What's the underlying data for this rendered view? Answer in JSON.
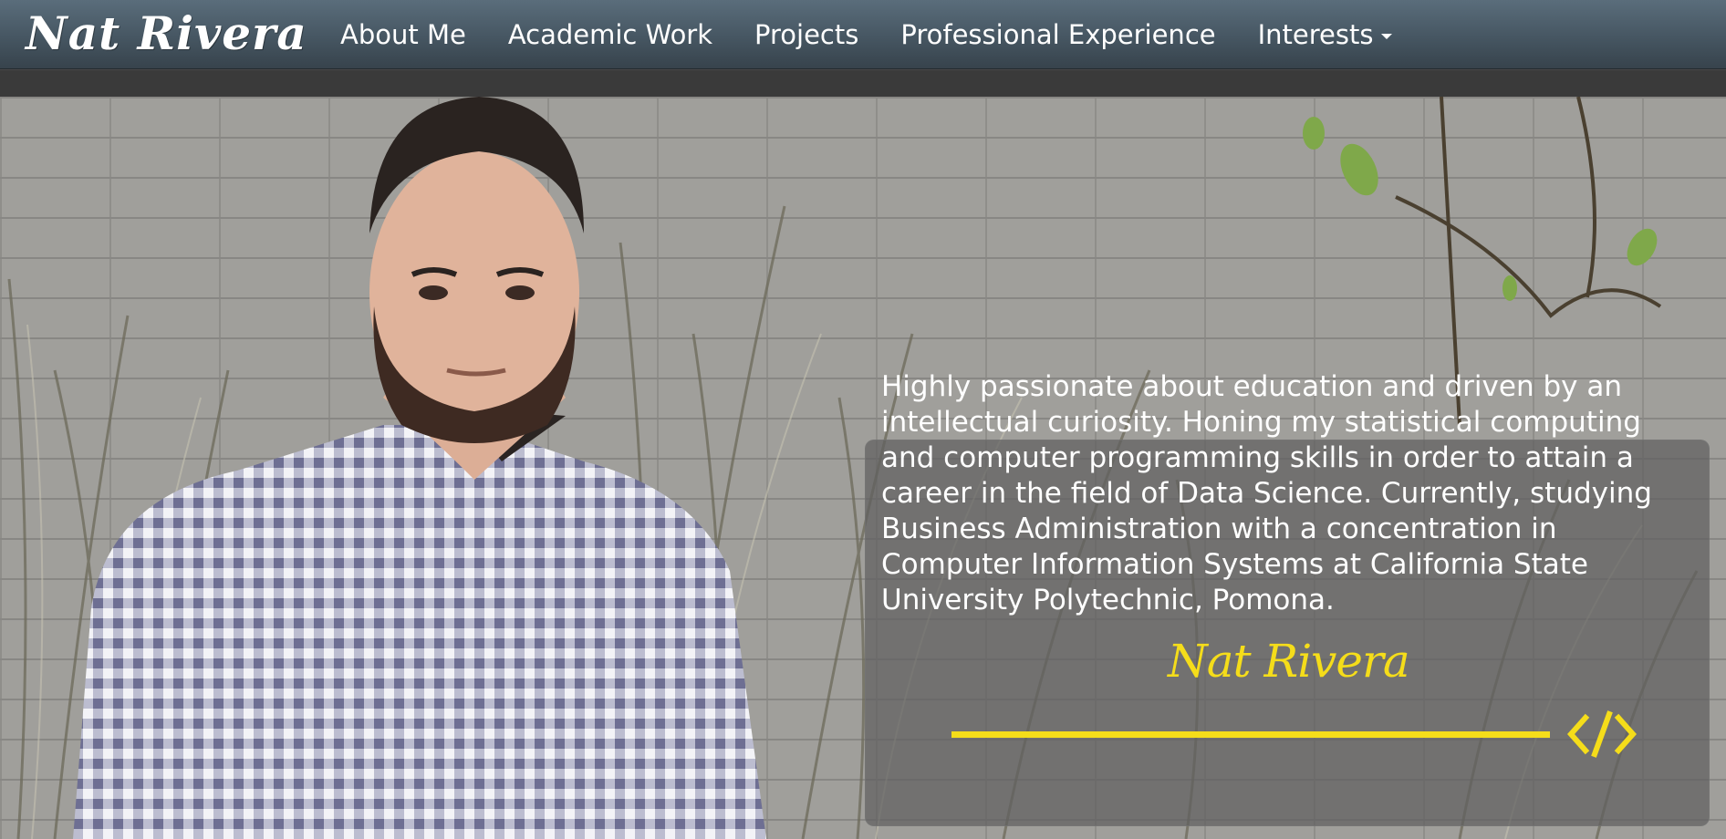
{
  "brand": {
    "name": "Nat Rivera"
  },
  "nav": {
    "items": [
      {
        "label": "About Me"
      },
      {
        "label": "Academic Work"
      },
      {
        "label": "Projects"
      },
      {
        "label": "Professional Experience"
      },
      {
        "label": "Interests"
      }
    ]
  },
  "hero": {
    "bio": "Highly passionate about education and driven by an intellectual curiosity. Honing my statistical computing and computer programming skills in order to attain a career in the field of Data Science. Currently, studying Business Administration with a concentration in Computer Information Systems at California State University Polytechnic, Pomona.",
    "signature": "Nat Rivera",
    "icon": "code-icon"
  },
  "colors": {
    "navbar": "#465662",
    "accent": "#f5dd1a",
    "text": "#ffffff"
  }
}
